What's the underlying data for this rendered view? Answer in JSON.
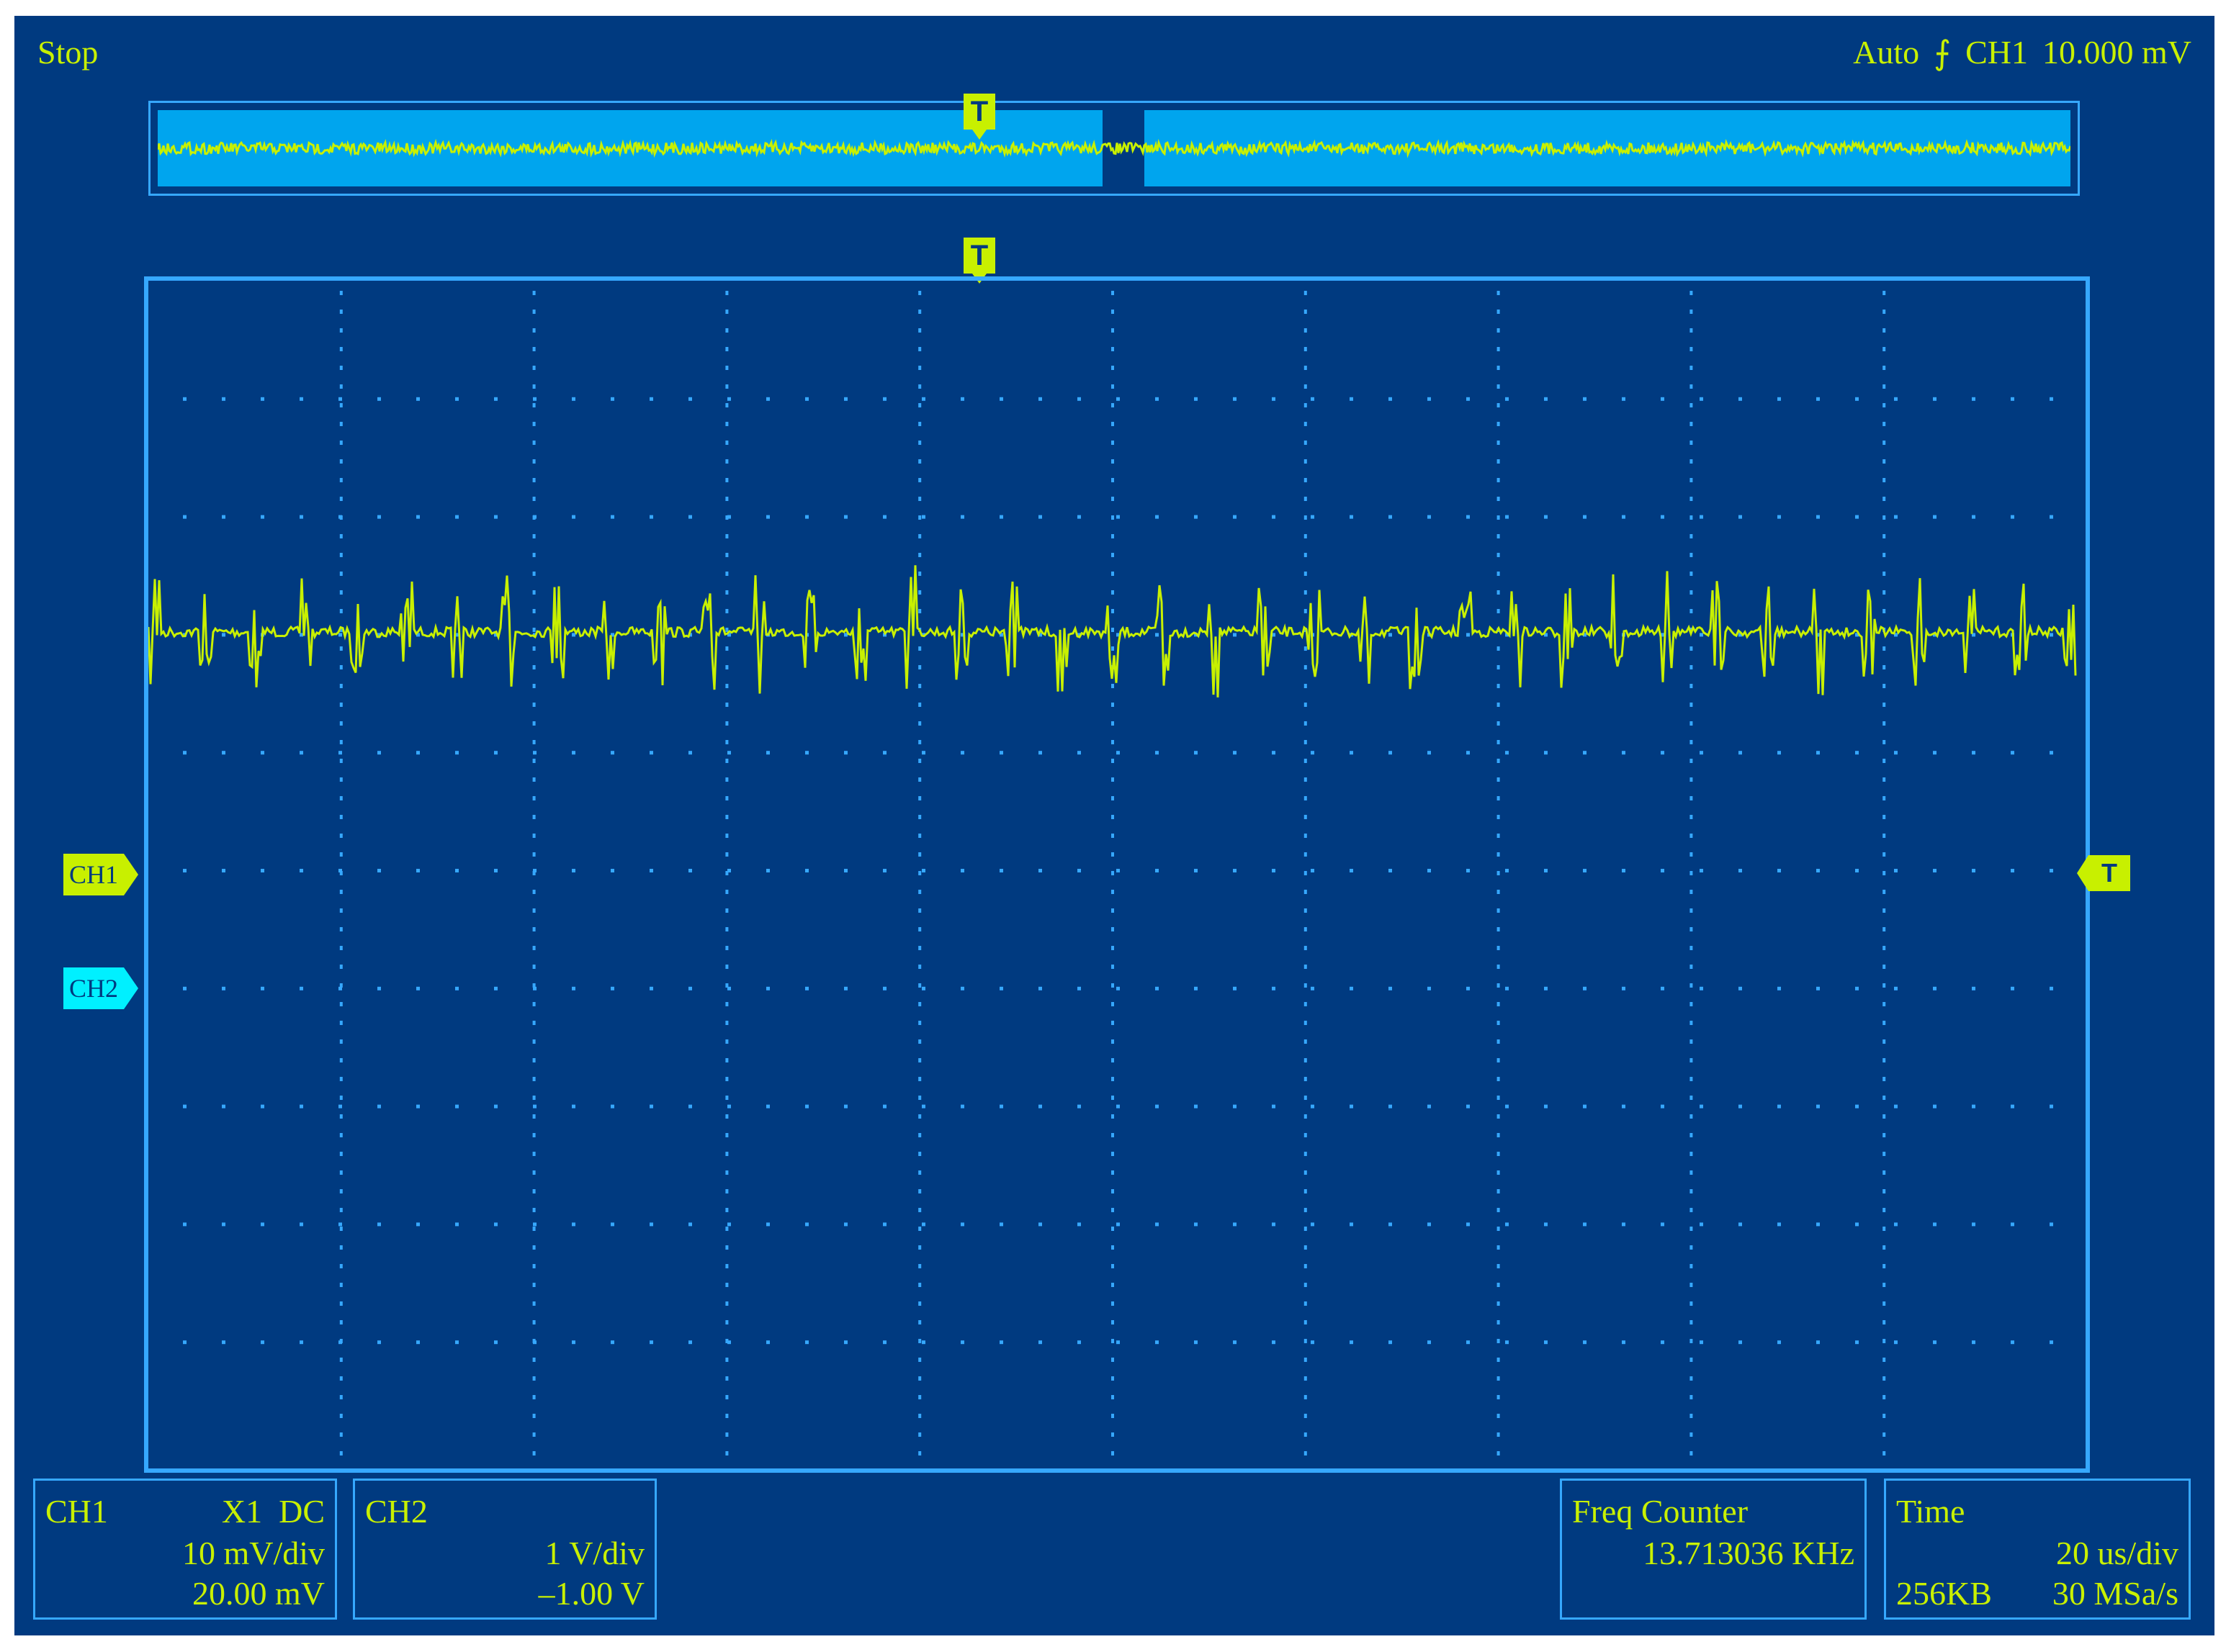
{
  "status": "Stop",
  "trigger": {
    "mode": "Auto",
    "source": "CH1",
    "level": "10.000 mV",
    "edge_icon": "rising-edge-icon",
    "marker_label": "T",
    "level_marker": "T"
  },
  "channels": {
    "ch1": {
      "marker": "CH1",
      "color": "#c8f000"
    },
    "ch2": {
      "marker": "CH2",
      "color": "#00f0ff"
    }
  },
  "panels": {
    "ch1": {
      "title": "CH1",
      "probe": "X1",
      "coupling": "DC",
      "scale": "10 mV/div",
      "offset": "20.00 mV"
    },
    "ch2": {
      "title": "CH2",
      "scale": "1 V/div",
      "offset": "–1.00 V"
    },
    "freq": {
      "title": "Freq Counter",
      "value": "13.713036 KHz"
    },
    "time": {
      "title": "Time",
      "timebase": "20 us/div",
      "memory": "256KB",
      "sample_rate": "30 MSa/s"
    }
  },
  "colors": {
    "background": "#003a80",
    "grid": "#36a8ff",
    "trace": "#c8f000",
    "overview_bg": "#00a5ee"
  }
}
